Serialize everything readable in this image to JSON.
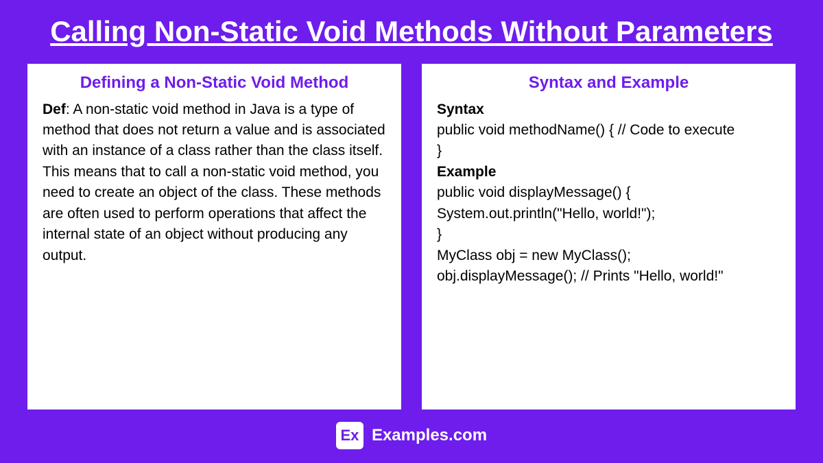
{
  "title": "Calling Non-Static Void Methods Without Parameters",
  "cards": {
    "left": {
      "heading": "Defining a Non-Static Void Method",
      "def_label": "Def",
      "def_text": ": A non-static void method in Java is a type of method that does not return a value and is associated with an instance of a class rather than the class itself. This means that to call a non-static void method, you need to create an object of the class. These methods are often used to perform operations that affect the internal state of an object without producing any output."
    },
    "right": {
      "heading": "Syntax and Example",
      "syntax_label": "Syntax",
      "syntax_line1": "public void methodName() { // Code to execute",
      "syntax_line2": "}",
      "example_label": "Example",
      "example_line1": "public void displayMessage() { System.out.println(\"Hello, world!\");",
      "example_line2": "}",
      "example_line3": "MyClass obj = new MyClass();",
      "example_line4": "obj.displayMessage(); // Prints \"Hello, world!\""
    }
  },
  "footer": {
    "logo": "Ex",
    "site": "Examples.com"
  }
}
